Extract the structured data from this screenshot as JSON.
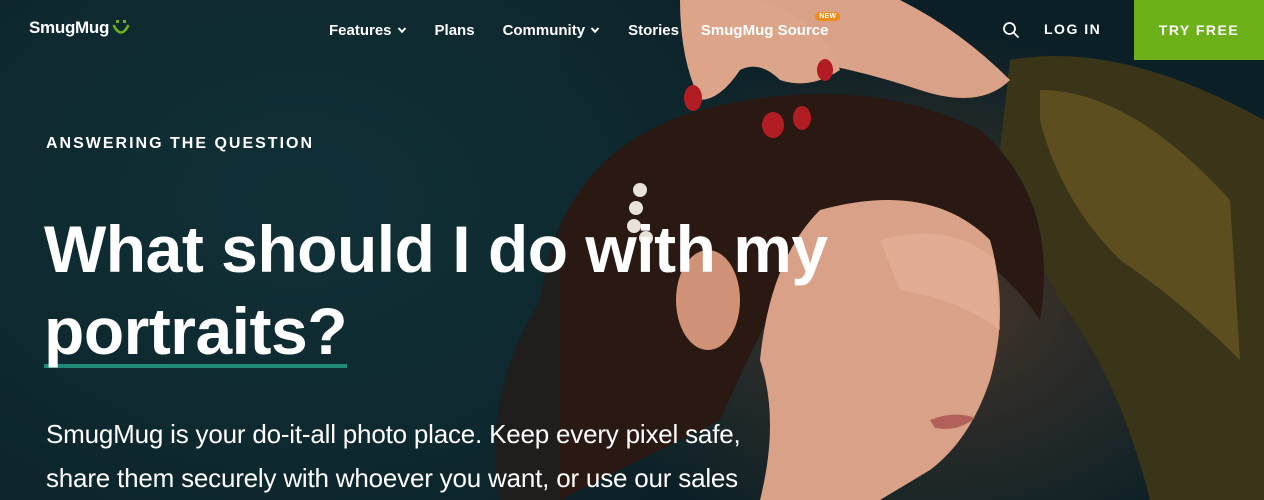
{
  "brand": {
    "name": "SmugMug",
    "accent_color": "#6cb01a"
  },
  "nav": {
    "items": [
      {
        "label": "Features",
        "has_dropdown": true
      },
      {
        "label": "Plans",
        "has_dropdown": false
      },
      {
        "label": "Community",
        "has_dropdown": true
      },
      {
        "label": "Stories",
        "has_dropdown": false
      },
      {
        "label": "SmugMug Source",
        "has_dropdown": false,
        "badge": "NEW"
      }
    ],
    "search_icon": "search-icon",
    "login_label": "LOG IN",
    "cta_label": "TRY FREE",
    "cta_color": "#6cb01a",
    "badge_color": "#ec8b1a"
  },
  "hero": {
    "eyebrow": "ANSWERING THE QUESTION",
    "headline_line1": "What should I do with my",
    "headline_accent": "portraits?",
    "underline_color": "#1f8a76",
    "subtext_line1": "SmugMug is your do-it-all photo place. Keep every pixel safe,",
    "subtext_line2": "share them securely with whoever you want, or use our sales"
  }
}
